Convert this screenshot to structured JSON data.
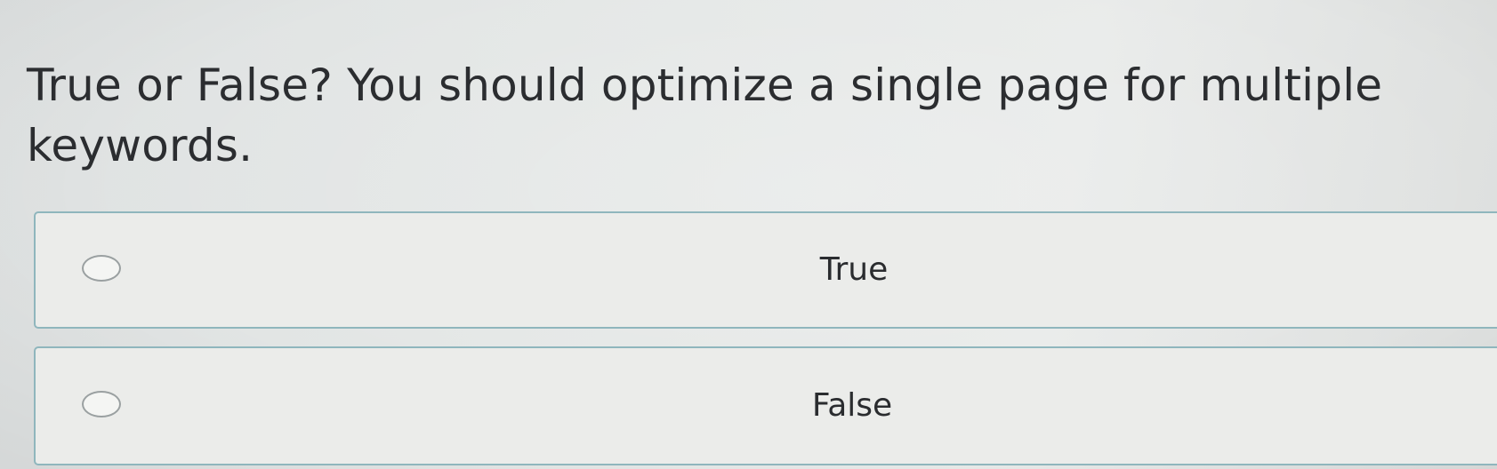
{
  "question": {
    "text": "True or False? You should optimize a single page for multiple keywords."
  },
  "options": [
    {
      "label": "True",
      "selected": false
    },
    {
      "label": "False",
      "selected": false
    }
  ],
  "colors": {
    "option_border": "#8fb6bd",
    "text": "#2b2d30",
    "radio_border": "#9aa0a1"
  },
  "icons": {
    "radio": "radio-unchecked-icon"
  }
}
